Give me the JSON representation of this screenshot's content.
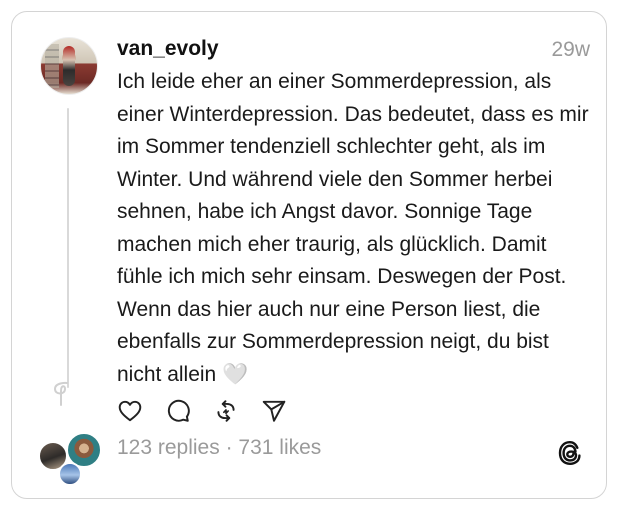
{
  "post": {
    "username": "van_evoly",
    "timestamp": "29w",
    "text": "Ich leide eher an einer Sommerdepression, als einer Winterdepression. Das bedeutet, dass es mir im Sommer tendenziell schlechter geht, als im Winter. Und während viele den Sommer herbei sehnen, habe ich Angst davor. Sonnige Tage machen mich eher traurig, als glücklich. Damit fühle ich mich sehr einsam. Deswegen der Post. Wenn das hier auch nur eine Person liest, die ebenfalls zur Sommerdepression neigt, du bist nicht allein 🤍"
  },
  "actions": [
    {
      "name": "like",
      "icon": "heart-icon"
    },
    {
      "name": "reply",
      "icon": "comment-icon"
    },
    {
      "name": "repost",
      "icon": "repost-icon"
    },
    {
      "name": "share",
      "icon": "send-icon"
    }
  ],
  "stats": {
    "replies": "123 replies",
    "separator": " · ",
    "likes": "731 likes"
  },
  "app": {
    "logo_icon": "threads-logo-icon"
  }
}
